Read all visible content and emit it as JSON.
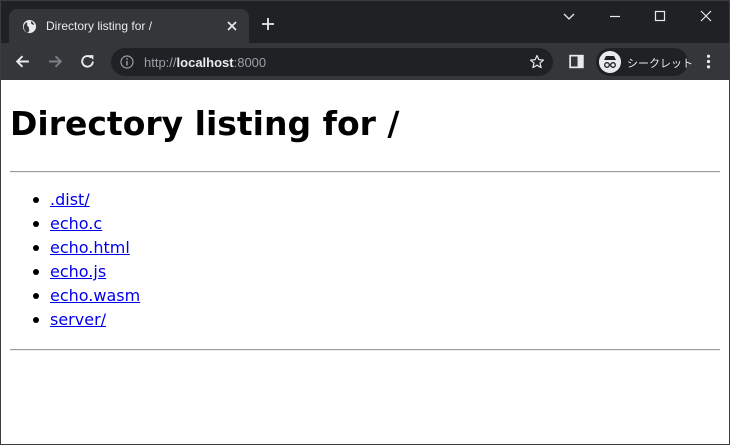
{
  "browser": {
    "tab": {
      "title": "Directory listing for /"
    },
    "address_bar": {
      "scheme": "http://",
      "host": "localhost",
      "port": ":8000"
    },
    "incognito_label": "シークレット"
  },
  "page": {
    "heading": "Directory listing for /",
    "entries": [
      {
        "name": ".dist/"
      },
      {
        "name": "echo.c"
      },
      {
        "name": "echo.html"
      },
      {
        "name": "echo.js"
      },
      {
        "name": "echo.wasm"
      },
      {
        "name": "server/"
      }
    ]
  }
}
